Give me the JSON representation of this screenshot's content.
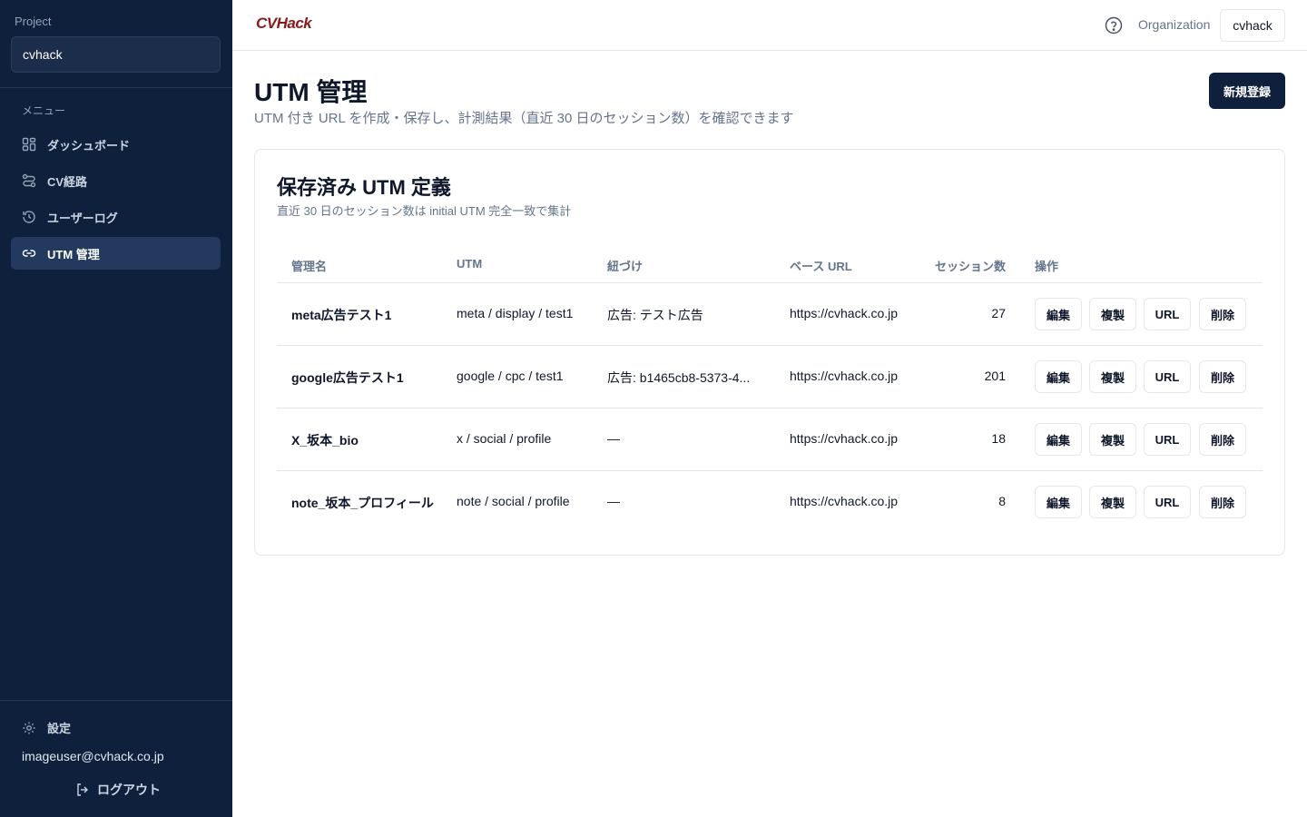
{
  "sidebar": {
    "project_label": "Project",
    "project_name": "cvhack",
    "menu_label": "メニュー",
    "items": [
      {
        "label": "ダッシュボード",
        "icon": "dashboard-grid-icon",
        "active": false
      },
      {
        "label": "CV経路",
        "icon": "route-icon",
        "active": false
      },
      {
        "label": "ユーザーログ",
        "icon": "history-icon",
        "active": false
      },
      {
        "label": "UTM 管理",
        "icon": "link-icon",
        "active": true
      }
    ],
    "settings_label": "設定",
    "user_email": "imageuser@cvhack.co.jp",
    "logout_label": "ログアウト"
  },
  "header": {
    "logo": "CVHack",
    "org_label": "Organization",
    "org_value": "cvhack"
  },
  "main": {
    "title": "UTM 管理",
    "subtitle": "UTM 付き URL を作成・保存し、計測結果（直近 30 日のセッション数）を確認できます",
    "new_button": "新規登録",
    "card": {
      "title": "保存済み UTM 定義",
      "subtitle": "直近 30 日のセッション数は initial UTM 完全一致で集計",
      "columns": [
        "管理名",
        "UTM",
        "紐づけ",
        "ベース URL",
        "セッション数",
        "操作"
      ],
      "rows": [
        {
          "name": "meta広告テスト1",
          "utm": "meta / display / test1",
          "link": "広告: テスト広告",
          "base_url": "https://cvhack.co.jp",
          "sessions": "27"
        },
        {
          "name": "google広告テスト1",
          "utm": "google / cpc / test1",
          "link": "広告: b1465cb8-5373-4...",
          "base_url": "https://cvhack.co.jp",
          "sessions": "201"
        },
        {
          "name": "X_坂本_bio",
          "utm": "x / social / profile",
          "link": "—",
          "base_url": "https://cvhack.co.jp",
          "sessions": "18"
        },
        {
          "name": "note_坂本_プロフィール",
          "utm": "note / social / profile",
          "link": "—",
          "base_url": "https://cvhack.co.jp",
          "sessions": "8"
        }
      ],
      "actions": {
        "edit": "編集",
        "copy": "複製",
        "url": "URL",
        "delete": "削除"
      }
    }
  },
  "colors": {
    "sidebar_bg": "#0f203d",
    "active_item_bg": "#233a5e",
    "primary_button": "#0f203d",
    "logo": "#8b1a1a"
  }
}
